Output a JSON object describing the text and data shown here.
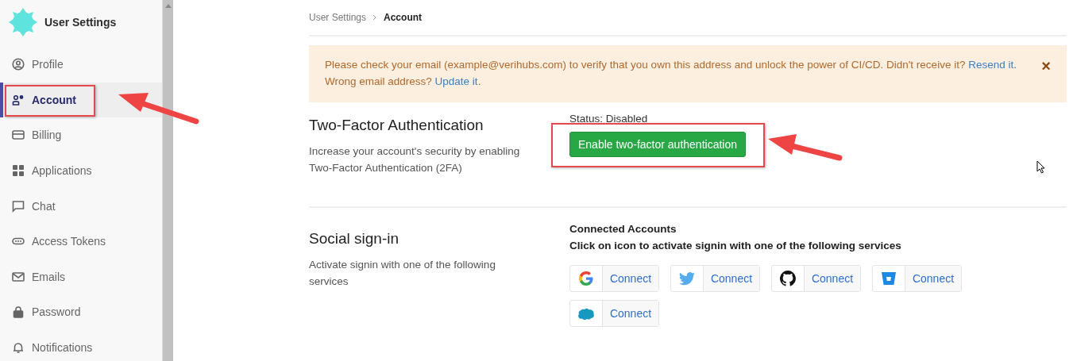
{
  "sidebar": {
    "title": "User Settings",
    "items": [
      {
        "label": "Profile",
        "kind": "profile",
        "selected": false,
        "annotated": false
      },
      {
        "label": "Account",
        "kind": "account",
        "selected": true,
        "annotated": true
      },
      {
        "label": "Billing",
        "kind": "billing",
        "selected": false,
        "annotated": false
      },
      {
        "label": "Applications",
        "kind": "apps",
        "selected": false,
        "annotated": false
      },
      {
        "label": "Chat",
        "kind": "chat",
        "selected": false,
        "annotated": false
      },
      {
        "label": "Access Tokens",
        "kind": "token",
        "selected": false,
        "annotated": false
      },
      {
        "label": "Emails",
        "kind": "mail",
        "selected": false,
        "annotated": false
      },
      {
        "label": "Password",
        "kind": "lock",
        "selected": false,
        "annotated": false
      },
      {
        "label": "Notifications",
        "kind": "bell",
        "selected": false,
        "annotated": false
      }
    ]
  },
  "breadcrumb": [
    {
      "label": "User Settings",
      "current": false
    },
    {
      "label": "Account",
      "current": true
    }
  ],
  "alert": {
    "lines": [
      [
        {
          "kind": "text",
          "text": "Please check your email (example@verihubs.com) to verify that you own this address and unlock the power of CI/CD. Didn't receive it? "
        },
        {
          "kind": "link",
          "text": "Resend it."
        }
      ],
      [
        {
          "kind": "text",
          "text": "Wrong email address? "
        },
        {
          "kind": "link",
          "text": "Update it"
        },
        {
          "kind": "text",
          "text": "."
        }
      ]
    ],
    "close": "×"
  },
  "two_factor": {
    "title": "Two-Factor Authentication",
    "description": "Increase your account's security by enabling Two-Factor Authentication (2FA)",
    "status": "Status: Disabled",
    "button": "Enable two-factor authentication",
    "annotated": true
  },
  "social": {
    "title": "Social sign-in",
    "description": "Activate signin with one of the following services",
    "heading": "Connected Accounts",
    "hint": "Click on icon to activate signin with one of the following services",
    "services": [
      {
        "kind": "google",
        "label": "Connect"
      },
      {
        "kind": "twitter",
        "label": "Connect"
      },
      {
        "kind": "github",
        "label": "Connect"
      },
      {
        "kind": "bitbucket",
        "label": "Connect"
      },
      {
        "kind": "salesforce",
        "label": "Connect"
      }
    ]
  }
}
